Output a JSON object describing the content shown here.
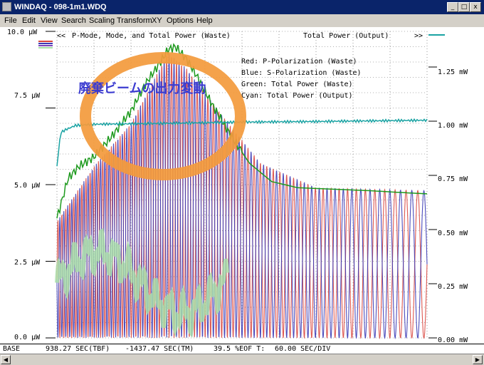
{
  "window": {
    "title": "WINDAQ - 098-1m1.WDQ",
    "controls": [
      "_",
      "□",
      "x"
    ]
  },
  "menu": [
    "File",
    "Edit",
    "View",
    "Search",
    "Scaling",
    "Transform",
    "XY",
    "Options",
    "Help"
  ],
  "status": {
    "base": "BASE",
    "tbf": "938.27 SEC(TBF)",
    "tm": "-1437.47 SEC(TM)",
    "eof": "39.5 %EOF T:",
    "div": "60.00 SEC/DIV"
  },
  "annotation": {
    "japanese_label": "廃棄ビームの出力変動",
    "circle_color": "#f39a3c"
  },
  "chart_data": {
    "type": "line",
    "header_left": "P-Mode,  Mode, and Total Power (Waste)",
    "header_right": "Total Power (Output)",
    "legend": [
      "Red: P-Polarization (Waste)",
      "Blue: S-Polarization (Waste)",
      "Green: Total Power (Waste)",
      "Cyan: Total Power (Output)"
    ],
    "left_axis": {
      "unit": "µW",
      "ticks": [
        "10.0 µW",
        "7.5 µW",
        "5.0 µW",
        "2.5 µW",
        "0.0 µW"
      ],
      "range": [
        0,
        10
      ]
    },
    "right_axis": {
      "unit": "mW",
      "ticks": [
        "1.25 mW",
        "1.00 mW",
        "0.75 mW",
        "0.50 mW",
        "0.25 mW",
        "0.00 mW"
      ],
      "range": [
        0,
        1.25
      ]
    },
    "x_divisions": 10,
    "series": [
      {
        "name": "P-Polarization (Waste)",
        "color": "#d9473f"
      },
      {
        "name": "S-Polarization (Waste)",
        "color": "#3a3ab5"
      },
      {
        "name": "Total Power (Waste)",
        "color": "#1e9a1e"
      },
      {
        "name": "Total Power (Output)",
        "color": "#1aa3a3"
      }
    ],
    "total_waste_envelope": [
      [
        0.0,
        3.9
      ],
      [
        0.3,
        5.2
      ],
      [
        0.6,
        5.6
      ],
      [
        1.0,
        5.9
      ],
      [
        1.5,
        6.6
      ],
      [
        2.0,
        7.4
      ],
      [
        2.4,
        8.3
      ],
      [
        2.8,
        9.0
      ],
      [
        3.0,
        9.4
      ],
      [
        3.2,
        9.5
      ],
      [
        3.5,
        9.1
      ],
      [
        3.8,
        8.5
      ],
      [
        4.2,
        7.6
      ],
      [
        4.7,
        6.6
      ],
      [
        5.2,
        5.7
      ],
      [
        5.8,
        5.1
      ],
      [
        6.5,
        4.9
      ],
      [
        7.5,
        4.85
      ],
      [
        8.5,
        4.8
      ],
      [
        9.2,
        4.75
      ],
      [
        10.0,
        4.7
      ]
    ],
    "output_total": [
      [
        0.0,
        5.6
      ],
      [
        0.1,
        6.7
      ],
      [
        0.25,
        6.8
      ],
      [
        0.5,
        6.93
      ],
      [
        1.0,
        6.97
      ],
      [
        3.0,
        7.0
      ],
      [
        5.0,
        7.04
      ],
      [
        7.0,
        7.06
      ],
      [
        10.0,
        7.1
      ]
    ],
    "oscillation_amplitude": [
      [
        0.0,
        3.8
      ],
      [
        1.0,
        5.6
      ],
      [
        2.0,
        7.0
      ],
      [
        3.0,
        9.3
      ],
      [
        3.5,
        8.8
      ],
      [
        4.5,
        7.2
      ],
      [
        5.5,
        5.7
      ],
      [
        7.0,
        4.9
      ],
      [
        10.0,
        4.8
      ]
    ]
  }
}
